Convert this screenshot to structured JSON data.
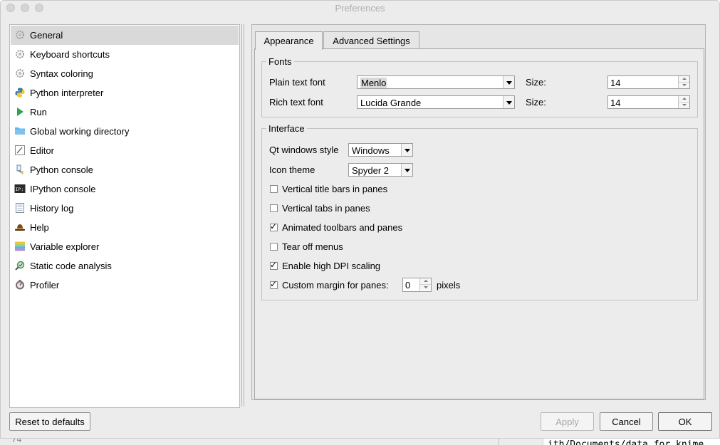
{
  "window": {
    "title": "Preferences"
  },
  "sidebar": {
    "items": [
      {
        "label": "General",
        "icon": "gear-icon",
        "selected": true
      },
      {
        "label": "Keyboard shortcuts",
        "icon": "gear-icon",
        "selected": false
      },
      {
        "label": "Syntax coloring",
        "icon": "gear-icon",
        "selected": false
      },
      {
        "label": "Python interpreter",
        "icon": "python-icon",
        "selected": false
      },
      {
        "label": "Run",
        "icon": "run-icon",
        "selected": false
      },
      {
        "label": "Global working directory",
        "icon": "folder-icon",
        "selected": false
      },
      {
        "label": "Editor",
        "icon": "editor-icon",
        "selected": false
      },
      {
        "label": "Python console",
        "icon": "python-console-icon",
        "selected": false
      },
      {
        "label": "IPython console",
        "icon": "ipython-icon",
        "selected": false
      },
      {
        "label": "History log",
        "icon": "history-icon",
        "selected": false
      },
      {
        "label": "Help",
        "icon": "help-icon",
        "selected": false
      },
      {
        "label": "Variable explorer",
        "icon": "variable-explorer-icon",
        "selected": false
      },
      {
        "label": "Static code analysis",
        "icon": "static-analysis-icon",
        "selected": false
      },
      {
        "label": "Profiler",
        "icon": "profiler-icon",
        "selected": false
      }
    ]
  },
  "tabs": [
    {
      "label": "Appearance",
      "active": true
    },
    {
      "label": "Advanced Settings",
      "active": false
    }
  ],
  "fonts": {
    "group_title": "Fonts",
    "plain_label": "Plain text font",
    "plain_value": "Menlo",
    "plain_size_label": "Size:",
    "plain_size": "14",
    "rich_label": "Rich text font",
    "rich_value": "Lucida Grande",
    "rich_size_label": "Size:",
    "rich_size": "14"
  },
  "interface": {
    "group_title": "Interface",
    "qt_style_label": "Qt windows style",
    "qt_style_value": "Windows",
    "icon_theme_label": "Icon theme",
    "icon_theme_value": "Spyder 2",
    "checkboxes": [
      {
        "label": "Vertical title bars in panes",
        "checked": false
      },
      {
        "label": "Vertical tabs in panes",
        "checked": false
      },
      {
        "label": "Animated toolbars and panes",
        "checked": true
      },
      {
        "label": "Tear off menus",
        "checked": false
      },
      {
        "label": "Enable high DPI scaling",
        "checked": true
      },
      {
        "label": "Custom margin for panes:",
        "checked": true
      }
    ],
    "margin_value": "0",
    "margin_unit": "pixels"
  },
  "buttons": {
    "reset": "Reset to defaults",
    "apply": "Apply",
    "cancel": "Cancel",
    "ok": "OK"
  },
  "background": {
    "left_text": "74",
    "code_text": "ith/Documents/data for knime"
  },
  "colors": {
    "selection": "#d9d9d9",
    "run_green": "#2ba24c",
    "folder_blue": "#5fb3e8"
  }
}
